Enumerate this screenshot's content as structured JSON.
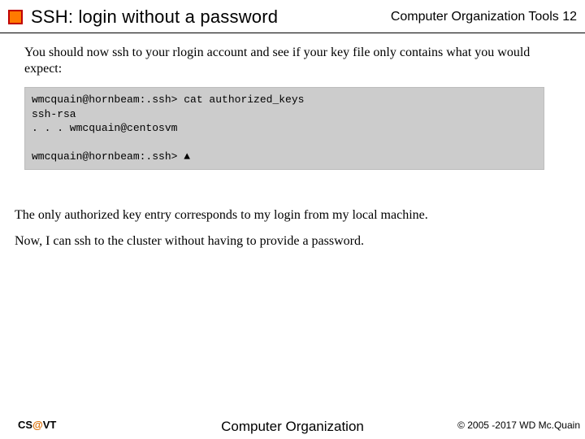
{
  "header": {
    "title": "SSH: login without a password",
    "course": "Computer Organization Tools 12"
  },
  "body": {
    "intro": "You should now ssh to your rlogin account and see if your key file only contains what you would expect:",
    "terminal": "wmcquain@hornbeam:.ssh> cat authorized_keys\nssh-rsa\n. . . wmcquain@centosvm\n\nwmcquain@hornbeam:.ssh> ▲",
    "p2": "The only authorized key entry corresponds to my login from my local machine.",
    "p3": "Now, I can ssh to the cluster without having to provide a password."
  },
  "footer": {
    "left_cs": "CS",
    "left_at": "@",
    "left_vt": "VT",
    "center": "Computer Organization",
    "right": "© 2005 -2017 WD Mc.Quain"
  }
}
